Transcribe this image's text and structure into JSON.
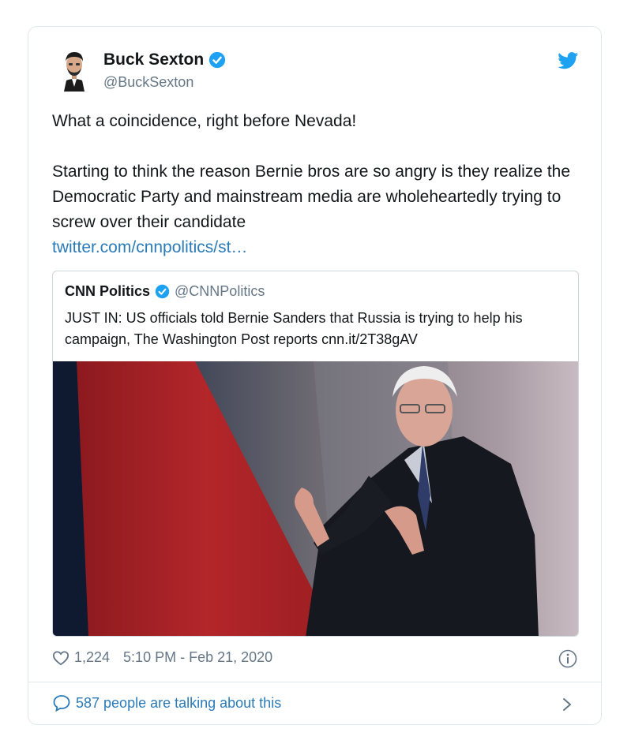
{
  "author": {
    "name": "Buck Sexton",
    "handle": "@BuckSexton"
  },
  "tweet": {
    "line1": "What a coincidence, right before Nevada!",
    "line2": "Starting to think the reason Bernie bros are so angry is they realize the Democratic Party and mainstream media are wholeheartedly trying to screw over their candidate",
    "link": "twitter.com/cnnpolitics/st…"
  },
  "quoted": {
    "name": "CNN Politics",
    "handle": "@CNNPolitics",
    "text": "JUST IN: US officials told Bernie Sanders that Russia is trying to help his campaign, The Washington Post reports cnn.it/2T38gAV"
  },
  "footer": {
    "likes": "1,224",
    "timestamp": "5:10 PM - Feb 21, 2020",
    "talking": "587 people are talking about this"
  },
  "colors": {
    "link": "#2b7bb9",
    "verified": "#1da1f2",
    "muted": "#657786",
    "border": "#e1e8ed"
  }
}
